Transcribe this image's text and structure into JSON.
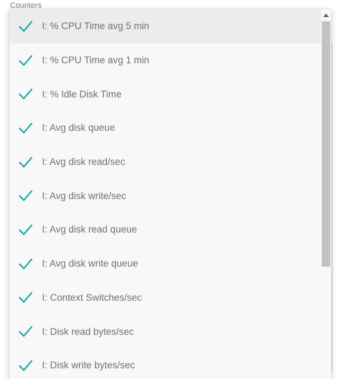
{
  "field": {
    "label": "Counters"
  },
  "colors": {
    "check": "#1aa3a3",
    "selected_bg": "#ececec",
    "thumb": "#c2c2c2"
  },
  "counters": {
    "items": [
      {
        "label": "I: % CPU Time avg 5 min",
        "checked": true,
        "highlighted": true
      },
      {
        "label": "I: % CPU Time avg 1 min",
        "checked": true
      },
      {
        "label": "I: % Idle Disk Time",
        "checked": true
      },
      {
        "label": "I: Avg disk queue",
        "checked": true
      },
      {
        "label": "I: Avg disk read/sec",
        "checked": true
      },
      {
        "label": "I: Avg disk write/sec",
        "checked": true
      },
      {
        "label": "I: Avg disk read queue",
        "checked": true
      },
      {
        "label": "I: Avg disk write queue",
        "checked": true
      },
      {
        "label": "I: Context Switches/sec",
        "checked": true
      },
      {
        "label": "I: Disk read bytes/sec",
        "checked": true
      },
      {
        "label": "I: Disk write bytes/sec",
        "checked": true
      }
    ]
  },
  "scrollbar": {
    "up_icon": "triangle-up-icon"
  }
}
